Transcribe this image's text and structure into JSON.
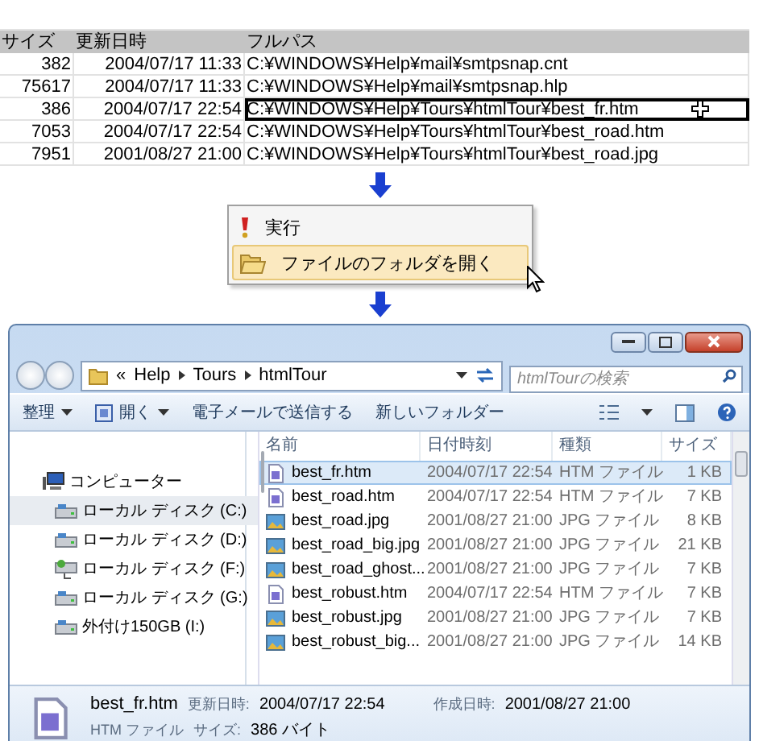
{
  "spreadsheet": {
    "columns": [
      "サイズ",
      "更新日時",
      "フルパス"
    ],
    "rows": [
      {
        "size": "382",
        "modified": "2004/07/17 11:33",
        "path": "C:¥WINDOWS¥Help¥mail¥smtpsnap.cnt",
        "selected": false
      },
      {
        "size": "75617",
        "modified": "2004/07/17 11:33",
        "path": "C:¥WINDOWS¥Help¥mail¥smtpsnap.hlp",
        "selected": false
      },
      {
        "size": "386",
        "modified": "2004/07/17 22:54",
        "path": "C:¥WINDOWS¥Help¥Tours¥htmlTour¥best_fr.htm",
        "selected": true
      },
      {
        "size": "7053",
        "modified": "2004/07/17 22:54",
        "path": "C:¥WINDOWS¥Help¥Tours¥htmlTour¥best_road.htm",
        "selected": false
      },
      {
        "size": "7951",
        "modified": "2001/08/27 21:00",
        "path": "C:¥WINDOWS¥Help¥Tours¥htmlTour¥best_road.jpg",
        "selected": false
      }
    ]
  },
  "context_menu": {
    "items": [
      {
        "label": "実行",
        "kind": "run",
        "selected": false
      },
      {
        "label": "ファイルのフォルダを開く",
        "kind": "folder",
        "selected": true
      }
    ]
  },
  "explorer": {
    "address": {
      "overflow": "«",
      "breadcrumbs": [
        "Help",
        "Tours",
        "htmlTour"
      ]
    },
    "search": {
      "placeholder": "htmlTourの検索"
    },
    "toolbar": [
      {
        "label": "整理",
        "kind": "menu"
      },
      {
        "label": "開く",
        "kind": "open"
      },
      {
        "label": "電子メールで送信する",
        "kind": "plain"
      },
      {
        "label": "新しいフォルダー",
        "kind": "plain"
      }
    ],
    "navigation": [
      {
        "label": "コンピューター",
        "kind": "computer",
        "selected": false,
        "children": [
          {
            "label": "ローカル ディスク (C:)",
            "kind": "drive",
            "selected": true
          },
          {
            "label": "ローカル ディスク (D:)",
            "kind": "drive",
            "selected": false
          },
          {
            "label": "ローカル ディスク (F:)",
            "kind": "shared",
            "selected": false
          },
          {
            "label": "ローカル ディスク (G:)",
            "kind": "drive",
            "selected": false
          },
          {
            "label": "外付け150GB (I:)",
            "kind": "drive",
            "selected": false
          }
        ]
      }
    ],
    "columns": [
      "名前",
      "日付時刻",
      "種類",
      "サイズ"
    ],
    "files": [
      {
        "name": "best_fr.htm",
        "date": "2004/07/17 22:54",
        "type": "HTM ファイル",
        "size": "1 KB",
        "kind": "htm",
        "selected": true
      },
      {
        "name": "best_road.htm",
        "date": "2004/07/17 22:54",
        "type": "HTM ファイル",
        "size": "7 KB",
        "kind": "htm",
        "selected": false
      },
      {
        "name": "best_road.jpg",
        "date": "2001/08/27 21:00",
        "type": "JPG ファイル",
        "size": "8 KB",
        "kind": "jpg",
        "selected": false
      },
      {
        "name": "best_road_big.jpg",
        "date": "2001/08/27 21:00",
        "type": "JPG ファイル",
        "size": "21 KB",
        "kind": "jpg",
        "selected": false
      },
      {
        "name": "best_road_ghost...",
        "date": "2001/08/27 21:00",
        "type": "JPG ファイル",
        "size": "7 KB",
        "kind": "jpg",
        "selected": false
      },
      {
        "name": "best_robust.htm",
        "date": "2004/07/17 22:54",
        "type": "HTM ファイル",
        "size": "7 KB",
        "kind": "htm",
        "selected": false
      },
      {
        "name": "best_robust.jpg",
        "date": "2001/08/27 21:00",
        "type": "JPG ファイル",
        "size": "7 KB",
        "kind": "jpg",
        "selected": false
      },
      {
        "name": "best_robust_big...",
        "date": "2001/08/27 21:00",
        "type": "JPG ファイル",
        "size": "14 KB",
        "kind": "jpg",
        "selected": false
      }
    ],
    "details": {
      "name": "best_fr.htm",
      "modified_label": "更新日時:",
      "modified": "2004/07/17 22:54",
      "created_label": "作成日時:",
      "created": "2001/08/27 21:00",
      "type": "HTM ファイル",
      "size_label": "サイズ:",
      "size": "386 バイト"
    }
  }
}
